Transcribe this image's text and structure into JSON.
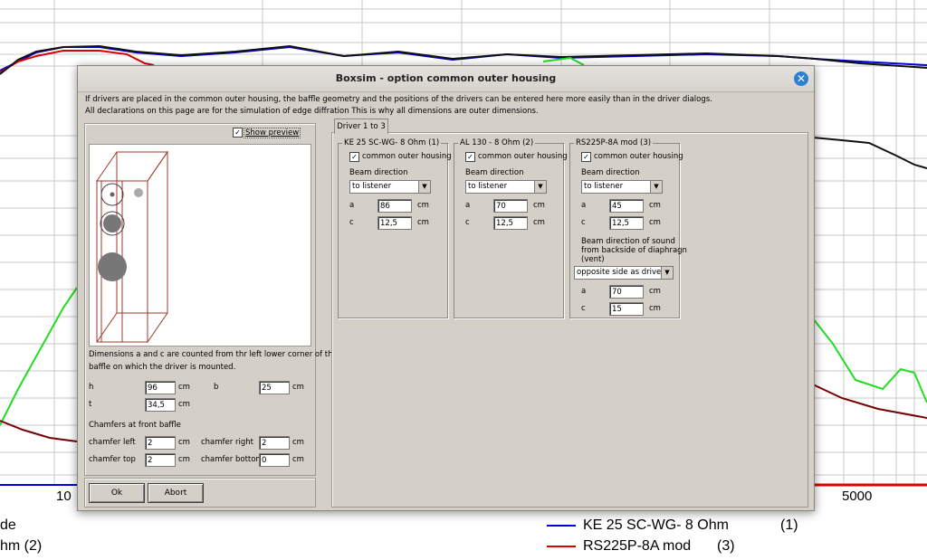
{
  "background": {
    "x_ticks": [
      "10",
      "5000"
    ],
    "legend": [
      {
        "label": "KE 25 SC-WG- 8 Ohm",
        "number": "(1)",
        "color": "#0000dd"
      },
      {
        "label": "RS225P-8A mod",
        "number": "(3)",
        "color": "#dd0000"
      }
    ],
    "left_legend": [
      "de",
      "hm (2)"
    ]
  },
  "dialog": {
    "title": "Boxsim - option common outer housing",
    "info_line1": "If drivers are placed in the common outer housing,  the baffle geometry and the positions of the drivers can be entered here more easily than in the driver dialogs.",
    "info_line2": "All declarations on this page are for the simulation of edge diffration This is why all dimensions are outer dimensions.",
    "show_preview_label": "Show preview",
    "show_preview_checked": true,
    "dimension_note_1": "Dimensions a and c are counted from thr left lower corner of the",
    "dimension_note_2": "baffle on which the driver is mounted.",
    "h_label": "h",
    "h_value": "96",
    "h_unit": "cm",
    "b_label": "b",
    "b_value": "25",
    "b_unit": "cm",
    "t_label": "t",
    "t_value": "34,5",
    "t_unit": "cm",
    "chamfers_heading": "Chamfers at front baffle",
    "chamfer_left_label": "chamfer left",
    "chamfer_left_value": "2",
    "chamfer_right_label": "chamfer right",
    "chamfer_right_value": "2",
    "chamfer_top_label": "chamfer top",
    "chamfer_top_value": "2",
    "chamfer_bottom_label": "chamfer bottom",
    "chamfer_bottom_value": "0",
    "unit_cm": "cm",
    "ok_label": "Ok",
    "abort_label": "Abort",
    "tab_label": "Driver 1 to 3"
  },
  "drivers": [
    {
      "title": "KE 25 SC-WG- 8 Ohm    (1)",
      "common_label": "common outer housing",
      "beam_label": "Beam direction",
      "beam_value": "to listener",
      "a_label": "a",
      "a_value": "86",
      "c_label": "c",
      "c_value": "12,5",
      "unit": "cm"
    },
    {
      "title": "AL 130 - 8 Ohm (2)",
      "common_label": "common outer housing",
      "beam_label": "Beam direction",
      "beam_value": "to listener",
      "a_label": "a",
      "a_value": "70",
      "c_label": "c",
      "c_value": "12,5",
      "unit": "cm"
    },
    {
      "title": "RS225P-8A mod (3)",
      "common_label": "common outer housing",
      "beam_label": "Beam direction",
      "beam_value": "to listener",
      "a_label": "a",
      "a_value": "45",
      "c_label": "c",
      "c_value": "12,5",
      "unit": "cm",
      "vent_label_1": "Beam direction of sound",
      "vent_label_2": "from backside of diaphragn",
      "vent_label_3": "(vent)",
      "vent_value": "opposite side as driver",
      "vent_a_value": "70",
      "vent_c_value": "15"
    }
  ]
}
